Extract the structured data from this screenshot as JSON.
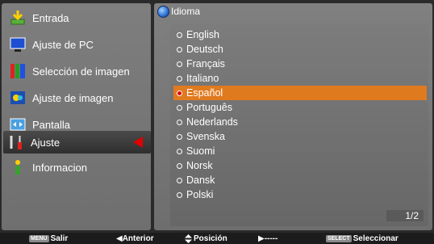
{
  "left_menu": {
    "items": [
      {
        "label": "Entrada",
        "icon": "input-arrow-icon"
      },
      {
        "label": "Ajuste de PC",
        "icon": "monitor-icon"
      },
      {
        "label": "Selección de imagen",
        "icon": "image-select-icon"
      },
      {
        "label": "Ajuste de imagen",
        "icon": "image-adjust-icon"
      },
      {
        "label": "Pantalla",
        "icon": "screen-icon"
      },
      {
        "label": "Ajuste",
        "icon": "tools-icon",
        "active": true
      },
      {
        "label": "Informacion",
        "icon": "info-icon"
      }
    ]
  },
  "right_panel": {
    "title": "Idioma",
    "languages": [
      "English",
      "Deutsch",
      "Français",
      "Italiano",
      "Español",
      "Português",
      "Nederlands",
      "Svenska",
      "Suomi",
      "Norsk",
      "Dansk",
      "Polski"
    ],
    "selected_language": "Español",
    "page_indicator": "1/2"
  },
  "footer": {
    "salir_key": "MENU",
    "salir_label": "Salir",
    "anterior_label": "◀Anterior",
    "posicion_label": "Posición",
    "next_label": "▶-----",
    "select_key": "SELECT",
    "select_label": "Seleccionar"
  },
  "colors": {
    "highlight": "#e07a1f",
    "arrow": "#e00000"
  }
}
